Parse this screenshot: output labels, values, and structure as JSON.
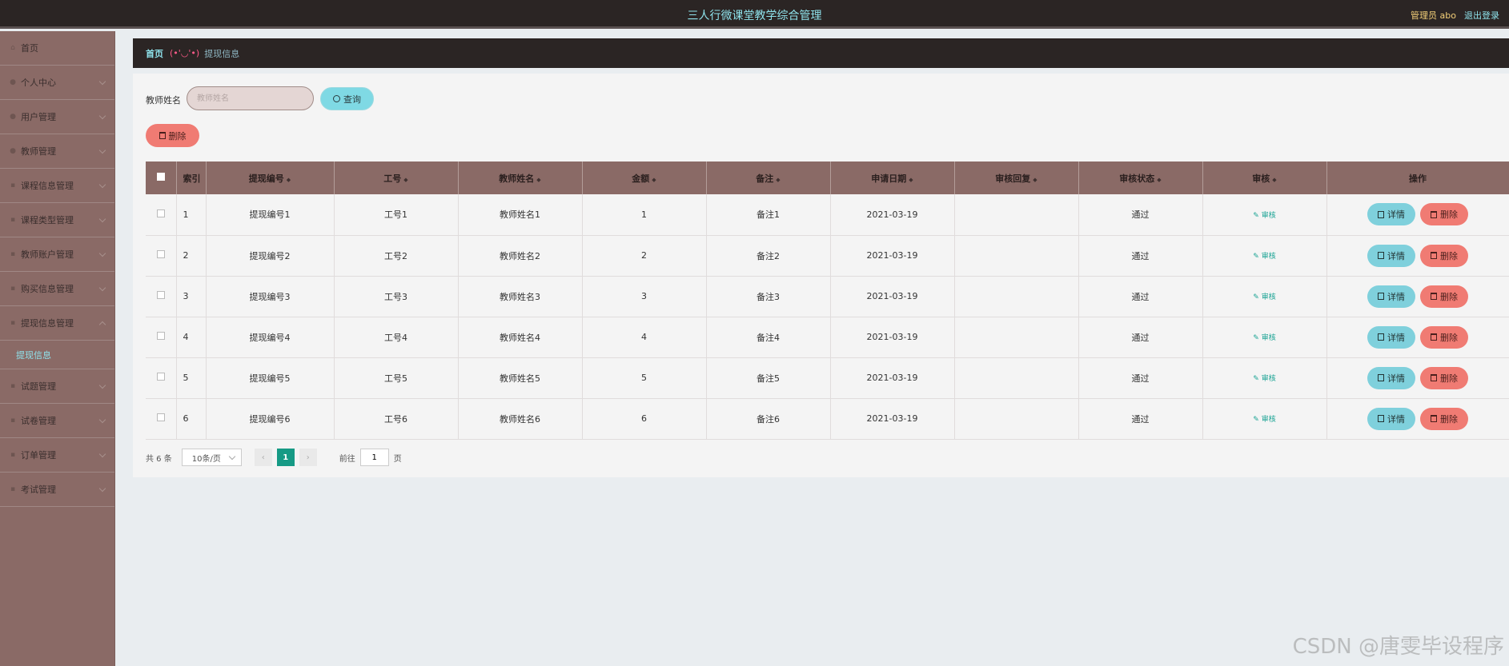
{
  "header": {
    "title": "三人行微课堂教学综合管理",
    "admin": "管理员 abo",
    "logout": "退出登录"
  },
  "sidebar": {
    "items": [
      {
        "label": "首页",
        "icon": "home-icon"
      },
      {
        "label": "个人中心",
        "icon": "user-icon"
      },
      {
        "label": "用户管理",
        "icon": "user-icon"
      },
      {
        "label": "教师管理",
        "icon": "user-icon"
      },
      {
        "label": "课程信息管理",
        "icon": "grid-icon"
      },
      {
        "label": "课程类型管理",
        "icon": "grid-icon"
      },
      {
        "label": "教师账户管理",
        "icon": "grid-icon"
      },
      {
        "label": "购买信息管理",
        "icon": "grid-icon"
      },
      {
        "label": "提现信息管理",
        "icon": "grid-icon"
      },
      {
        "label": "试题管理",
        "icon": "grid-icon"
      },
      {
        "label": "试卷管理",
        "icon": "grid-icon"
      },
      {
        "label": "订单管理",
        "icon": "grid-icon"
      },
      {
        "label": "考试管理",
        "icon": "grid-icon"
      }
    ],
    "sub_item": "提现信息"
  },
  "breadcrumb": {
    "home": "首页",
    "face": "(•'◡'•)",
    "current": "提现信息"
  },
  "search": {
    "label": "教师姓名",
    "placeholder": "教师姓名",
    "query_label": "查询"
  },
  "toolbar": {
    "delete_label": "删除"
  },
  "table": {
    "headers": [
      "索引",
      "提现编号",
      "工号",
      "教师姓名",
      "金额",
      "备注",
      "申请日期",
      "审核回复",
      "审核状态",
      "审核",
      "操作"
    ],
    "rows": [
      {
        "index": "1",
        "no": "提现编号1",
        "job_no": "工号1",
        "teacher": "教师姓名1",
        "amount": "1",
        "note": "备注1",
        "date": "2021-03-19",
        "reply": "",
        "status": "通过",
        "audit": "审核"
      },
      {
        "index": "2",
        "no": "提现编号2",
        "job_no": "工号2",
        "teacher": "教师姓名2",
        "amount": "2",
        "note": "备注2",
        "date": "2021-03-19",
        "reply": "",
        "status": "通过",
        "audit": "审核"
      },
      {
        "index": "3",
        "no": "提现编号3",
        "job_no": "工号3",
        "teacher": "教师姓名3",
        "amount": "3",
        "note": "备注3",
        "date": "2021-03-19",
        "reply": "",
        "status": "通过",
        "audit": "审核"
      },
      {
        "index": "4",
        "no": "提现编号4",
        "job_no": "工号4",
        "teacher": "教师姓名4",
        "amount": "4",
        "note": "备注4",
        "date": "2021-03-19",
        "reply": "",
        "status": "通过",
        "audit": "审核"
      },
      {
        "index": "5",
        "no": "提现编号5",
        "job_no": "工号5",
        "teacher": "教师姓名5",
        "amount": "5",
        "note": "备注5",
        "date": "2021-03-19",
        "reply": "",
        "status": "通过",
        "audit": "审核"
      },
      {
        "index": "6",
        "no": "提现编号6",
        "job_no": "工号6",
        "teacher": "教师姓名6",
        "amount": "6",
        "note": "备注6",
        "date": "2021-03-19",
        "reply": "",
        "status": "通过",
        "audit": "审核"
      }
    ],
    "detail_label": "详情",
    "delete_label": "删除"
  },
  "pager": {
    "total": "共 6 条",
    "page_size": "10条/页",
    "current_page": "1",
    "goto_prefix": "前往",
    "goto_value": "1",
    "goto_suffix": "页"
  },
  "watermark": "CSDN @唐雯毕设程序",
  "colors": {
    "topbar": "#2b2524",
    "sidebar": "#8a6a66",
    "accent": "#8fe3ec",
    "danger": "#f07b73",
    "info": "#7fd0dc"
  }
}
